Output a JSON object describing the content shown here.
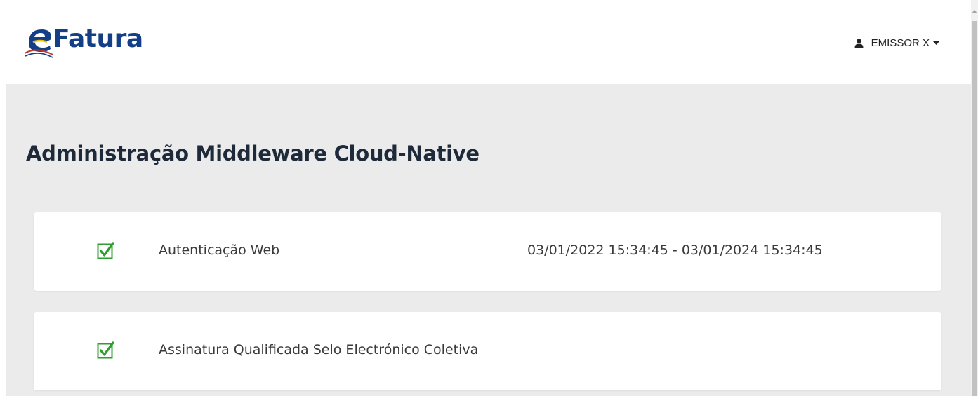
{
  "header": {
    "logo_text": "Fatura",
    "logo_letter": "e",
    "user_label": "EMISSOR X"
  },
  "main": {
    "title": "Administração Middleware Cloud-Native",
    "items": [
      {
        "checked": true,
        "label": "Autenticação Web",
        "validity": "03/01/2022 15:34:45 - 03/01/2024 15:34:45"
      },
      {
        "checked": true,
        "label": "Assinatura Qualificada Selo Electrónico Coletiva",
        "validity": ""
      }
    ]
  },
  "colors": {
    "brand": "#143f87",
    "check": "#2e9e2e",
    "background": "#ebebeb",
    "title": "#1e2a3a"
  },
  "icons": {
    "user": "user-icon",
    "caret": "caret-down-icon",
    "check": "checkbox-checked-icon",
    "logo": "efatura-logo"
  }
}
